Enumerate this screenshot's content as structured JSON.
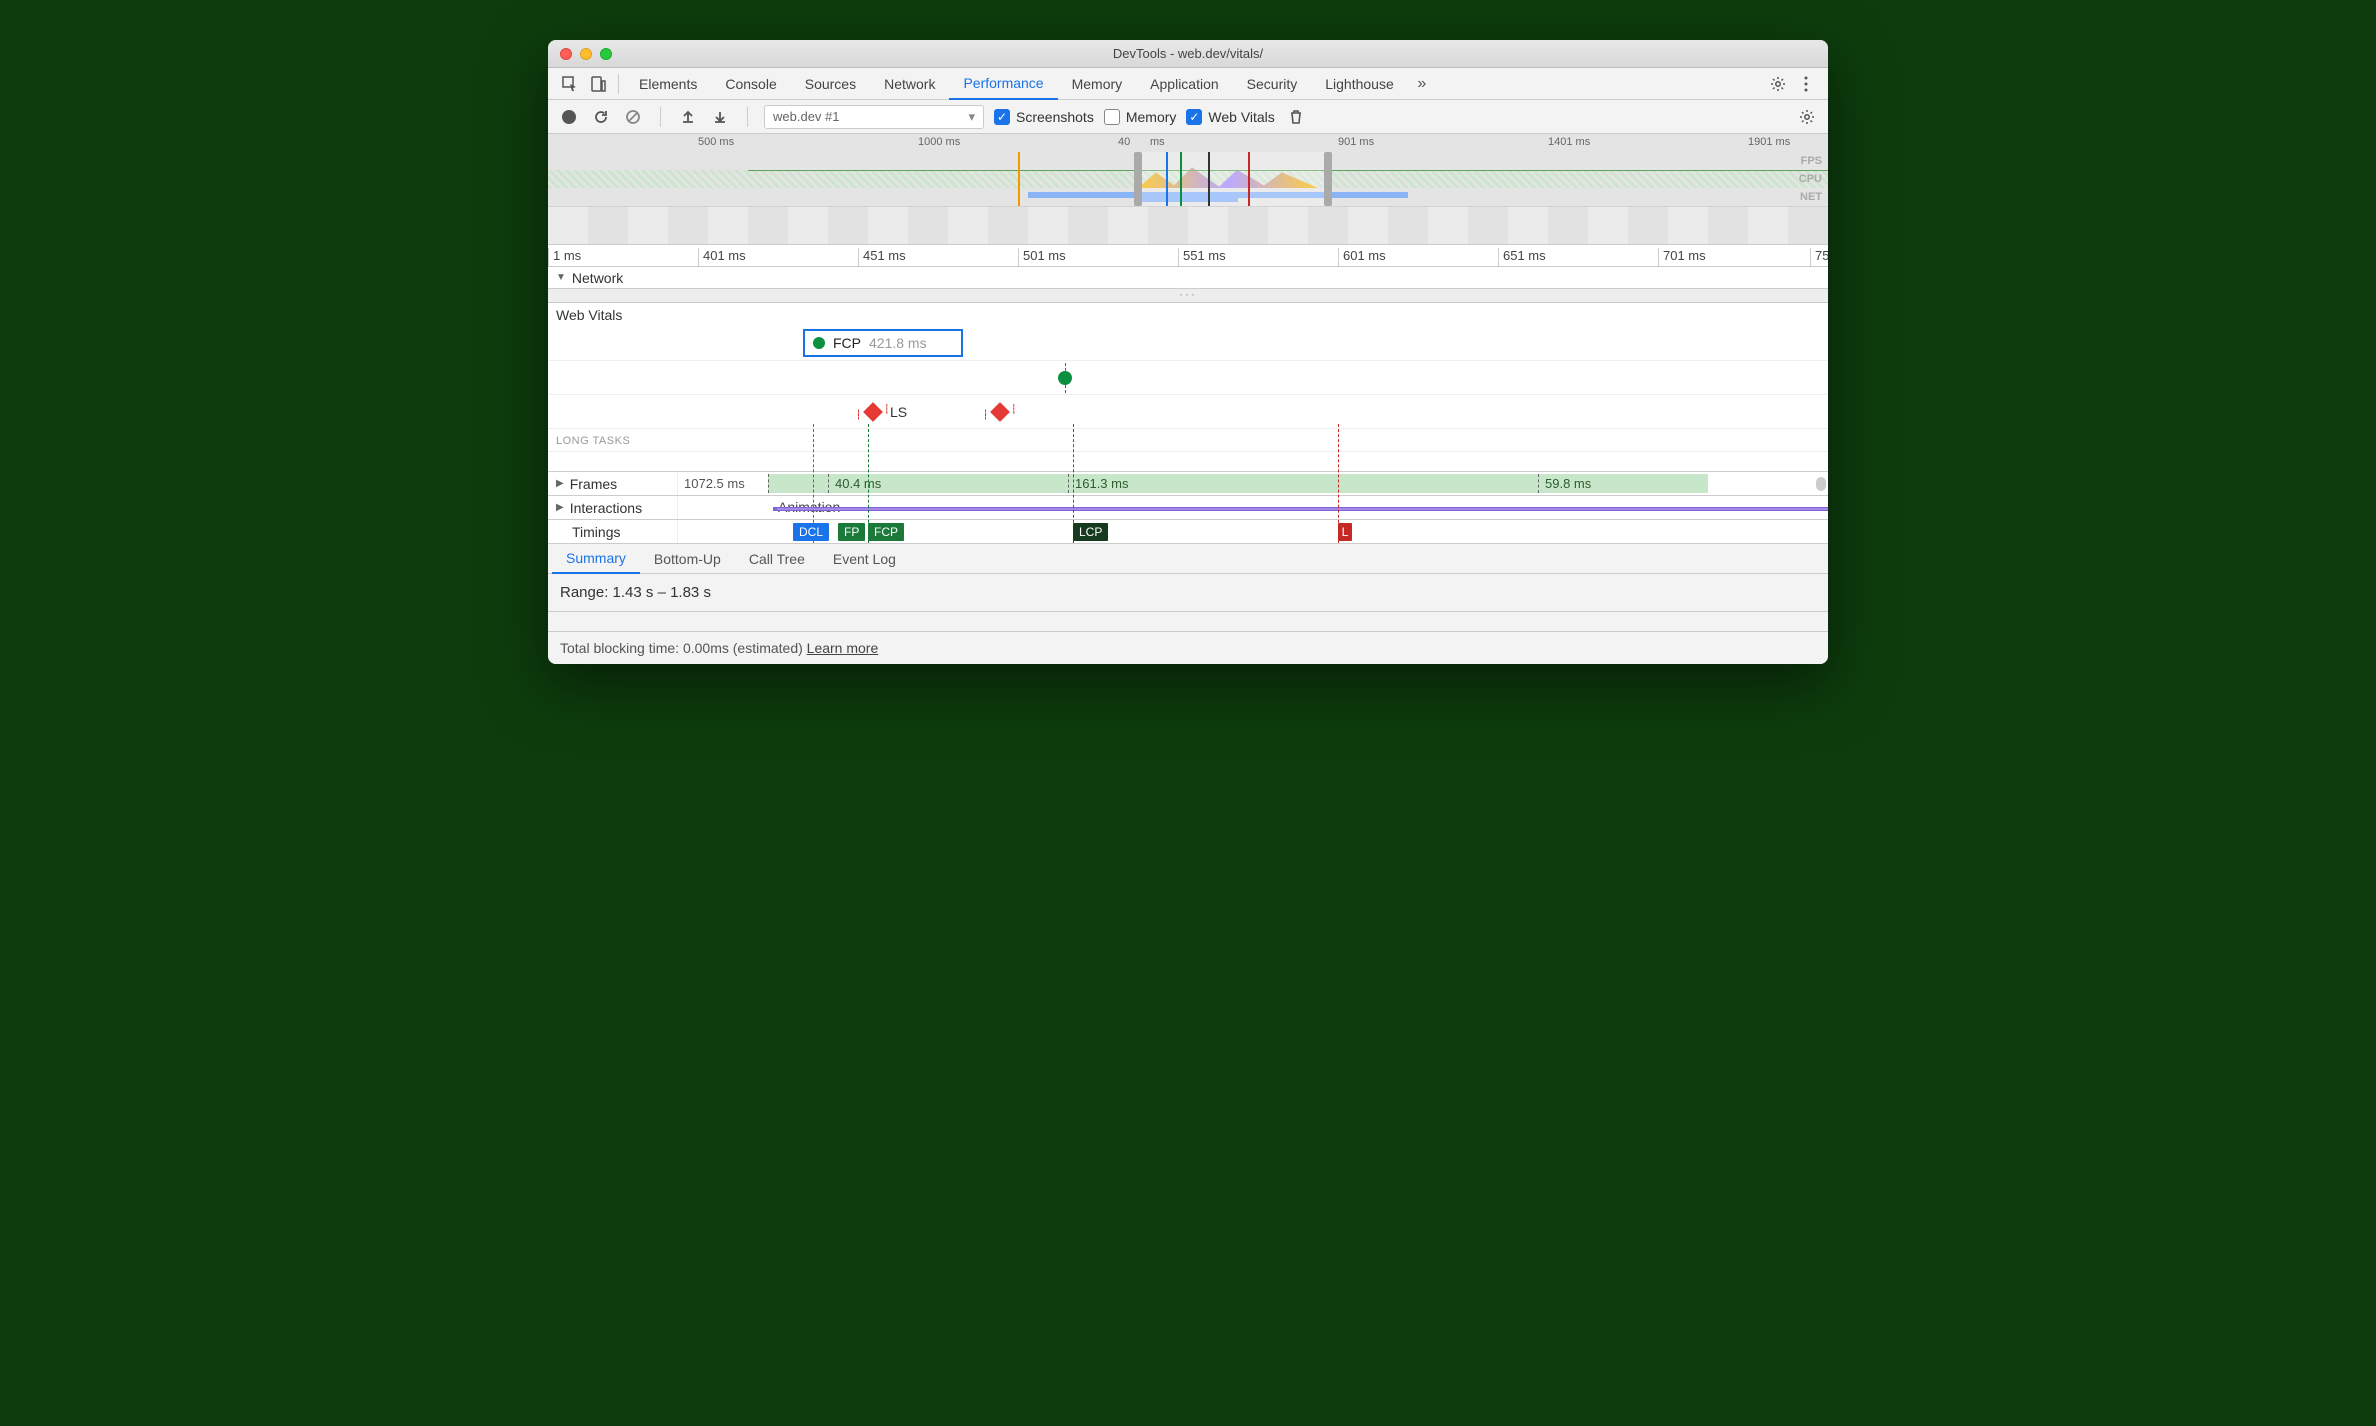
{
  "window": {
    "title": "DevTools - web.dev/vitals/"
  },
  "mainTabs": [
    "Elements",
    "Console",
    "Sources",
    "Network",
    "Performance",
    "Memory",
    "Application",
    "Security",
    "Lighthouse"
  ],
  "mainTabActive": "Performance",
  "toolbar": {
    "selectValue": "web.dev #1",
    "screenshots": {
      "label": "Screenshots",
      "checked": true
    },
    "memory": {
      "label": "Memory",
      "checked": false
    },
    "webvitals": {
      "label": "Web Vitals",
      "checked": true
    }
  },
  "overview": {
    "ticks": [
      "500 ms",
      "1000 ms",
      "40",
      "ms",
      "901 ms",
      "1401 ms",
      "1901 ms"
    ],
    "labels": {
      "fps": "FPS",
      "cpu": "CPU",
      "net": "NET"
    }
  },
  "ruler": [
    "1 ms",
    "401 ms",
    "451 ms",
    "501 ms",
    "551 ms",
    "601 ms",
    "651 ms",
    "701 ms",
    "75"
  ],
  "sections": {
    "network": "Network",
    "webvitals": "Web Vitals",
    "longtasks": "LONG TASKS",
    "frames": "Frames",
    "interactions": "Interactions",
    "timings": "Timings"
  },
  "webvitals": {
    "fcp": {
      "label": "FCP",
      "time": "421.8 ms"
    },
    "ls": {
      "label": "LS"
    }
  },
  "frames": {
    "first": "1072.5 ms",
    "segs": [
      "",
      "40.4 ms",
      "161.3 ms",
      "59.8 ms"
    ]
  },
  "interactions": {
    "label": "Animation"
  },
  "timings": {
    "dcl": "DCL",
    "fp": "FP",
    "fcp": "FCP",
    "lcp": "LCP",
    "l": "L"
  },
  "bottomTabs": [
    "Summary",
    "Bottom-Up",
    "Call Tree",
    "Event Log"
  ],
  "bottomActive": "Summary",
  "summary": {
    "range": "Range: 1.43 s – 1.83 s"
  },
  "footer": {
    "text": "Total blocking time: 0.00ms (estimated)",
    "link": "Learn more"
  }
}
